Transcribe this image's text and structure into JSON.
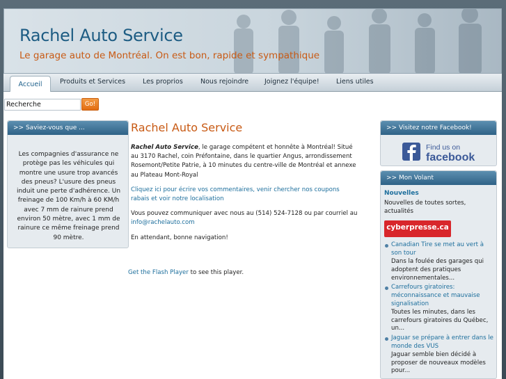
{
  "header": {
    "title": "Rachel Auto Service",
    "tagline": "Le garage auto de Montréal. On est bon, rapide et sympathique"
  },
  "nav": {
    "active": "Accueil",
    "items": [
      "Produits et Services",
      "Les proprios",
      "Nous rejoindre",
      "Joignez l'équipe!",
      "Liens utiles"
    ]
  },
  "search": {
    "value": "Recherche",
    "button": "Go!"
  },
  "left_box": {
    "heading": ">> Saviez-vous que ...",
    "text": "Les compagnies d'assurance ne protège pas les véhicules qui montre une usure trop avancés des pneus? L'usure des pneus induit une perte d'adhérence. Un freinage de 100 Km/h à 60 KM/h avec 7 mm de rainure prend environ 50 mètre, avec 1 mm de rainure ce même freinage prend 90 mètre."
  },
  "main": {
    "title": "Rachel Auto Service",
    "intro_bold": "Rachel Auto Service",
    "intro_rest": ", le garage compétent et honnête à Montréal! Situé au 3170 Rachel, coin Préfontaine, dans le quartier Angus, arrondissement Rosemont/Petite Patrie, à 10 minutes du centre-ville de Montréal et annexe au Plateau Mont-Royal",
    "link_text": "Cliquez ici pour écrire vos commentaires, venir chercher nos coupons rabais et voir notre localisation",
    "contact_text": "Vous pouvez communiquer avec nous au (514) 524-7128 ou par courriel au ",
    "email": "info@rachelauto.com",
    "closing": "En attendant, bonne navigation!",
    "flash_link": "Get the Flash Player",
    "flash_rest": " to see this player."
  },
  "facebook_box": {
    "heading": ">> Visitez notre Facebook!",
    "find_us": "Find us on",
    "brand": "facebook"
  },
  "volant_box": {
    "heading": ">> Mon Volant",
    "nouvelles": "Nouvelles",
    "nouvelles_desc": "Nouvelles de toutes sortes, actualités",
    "source": "cyberpresse.ca",
    "news": [
      {
        "title": "Canadian Tire se met au vert à son tour",
        "desc": "Dans la foulée des garages qui adoptent des pratiques environnementales..."
      },
      {
        "title": "Carrefours giratoires: méconnaissance et mauvaise signalisation",
        "desc": "Toutes les minutes, dans les carrefours giratoires du Québec, un..."
      },
      {
        "title": "Jaguar se prépare à entrer dans le monde des VUS",
        "desc": "Jaguar semble bien décidé à proposer de nouveaux modèles pour..."
      }
    ]
  },
  "colors": {
    "accent_orange": "#c85a14",
    "title_blue": "#1d5c83",
    "link_blue": "#1c6e9c",
    "box_head": "#2f6287"
  }
}
